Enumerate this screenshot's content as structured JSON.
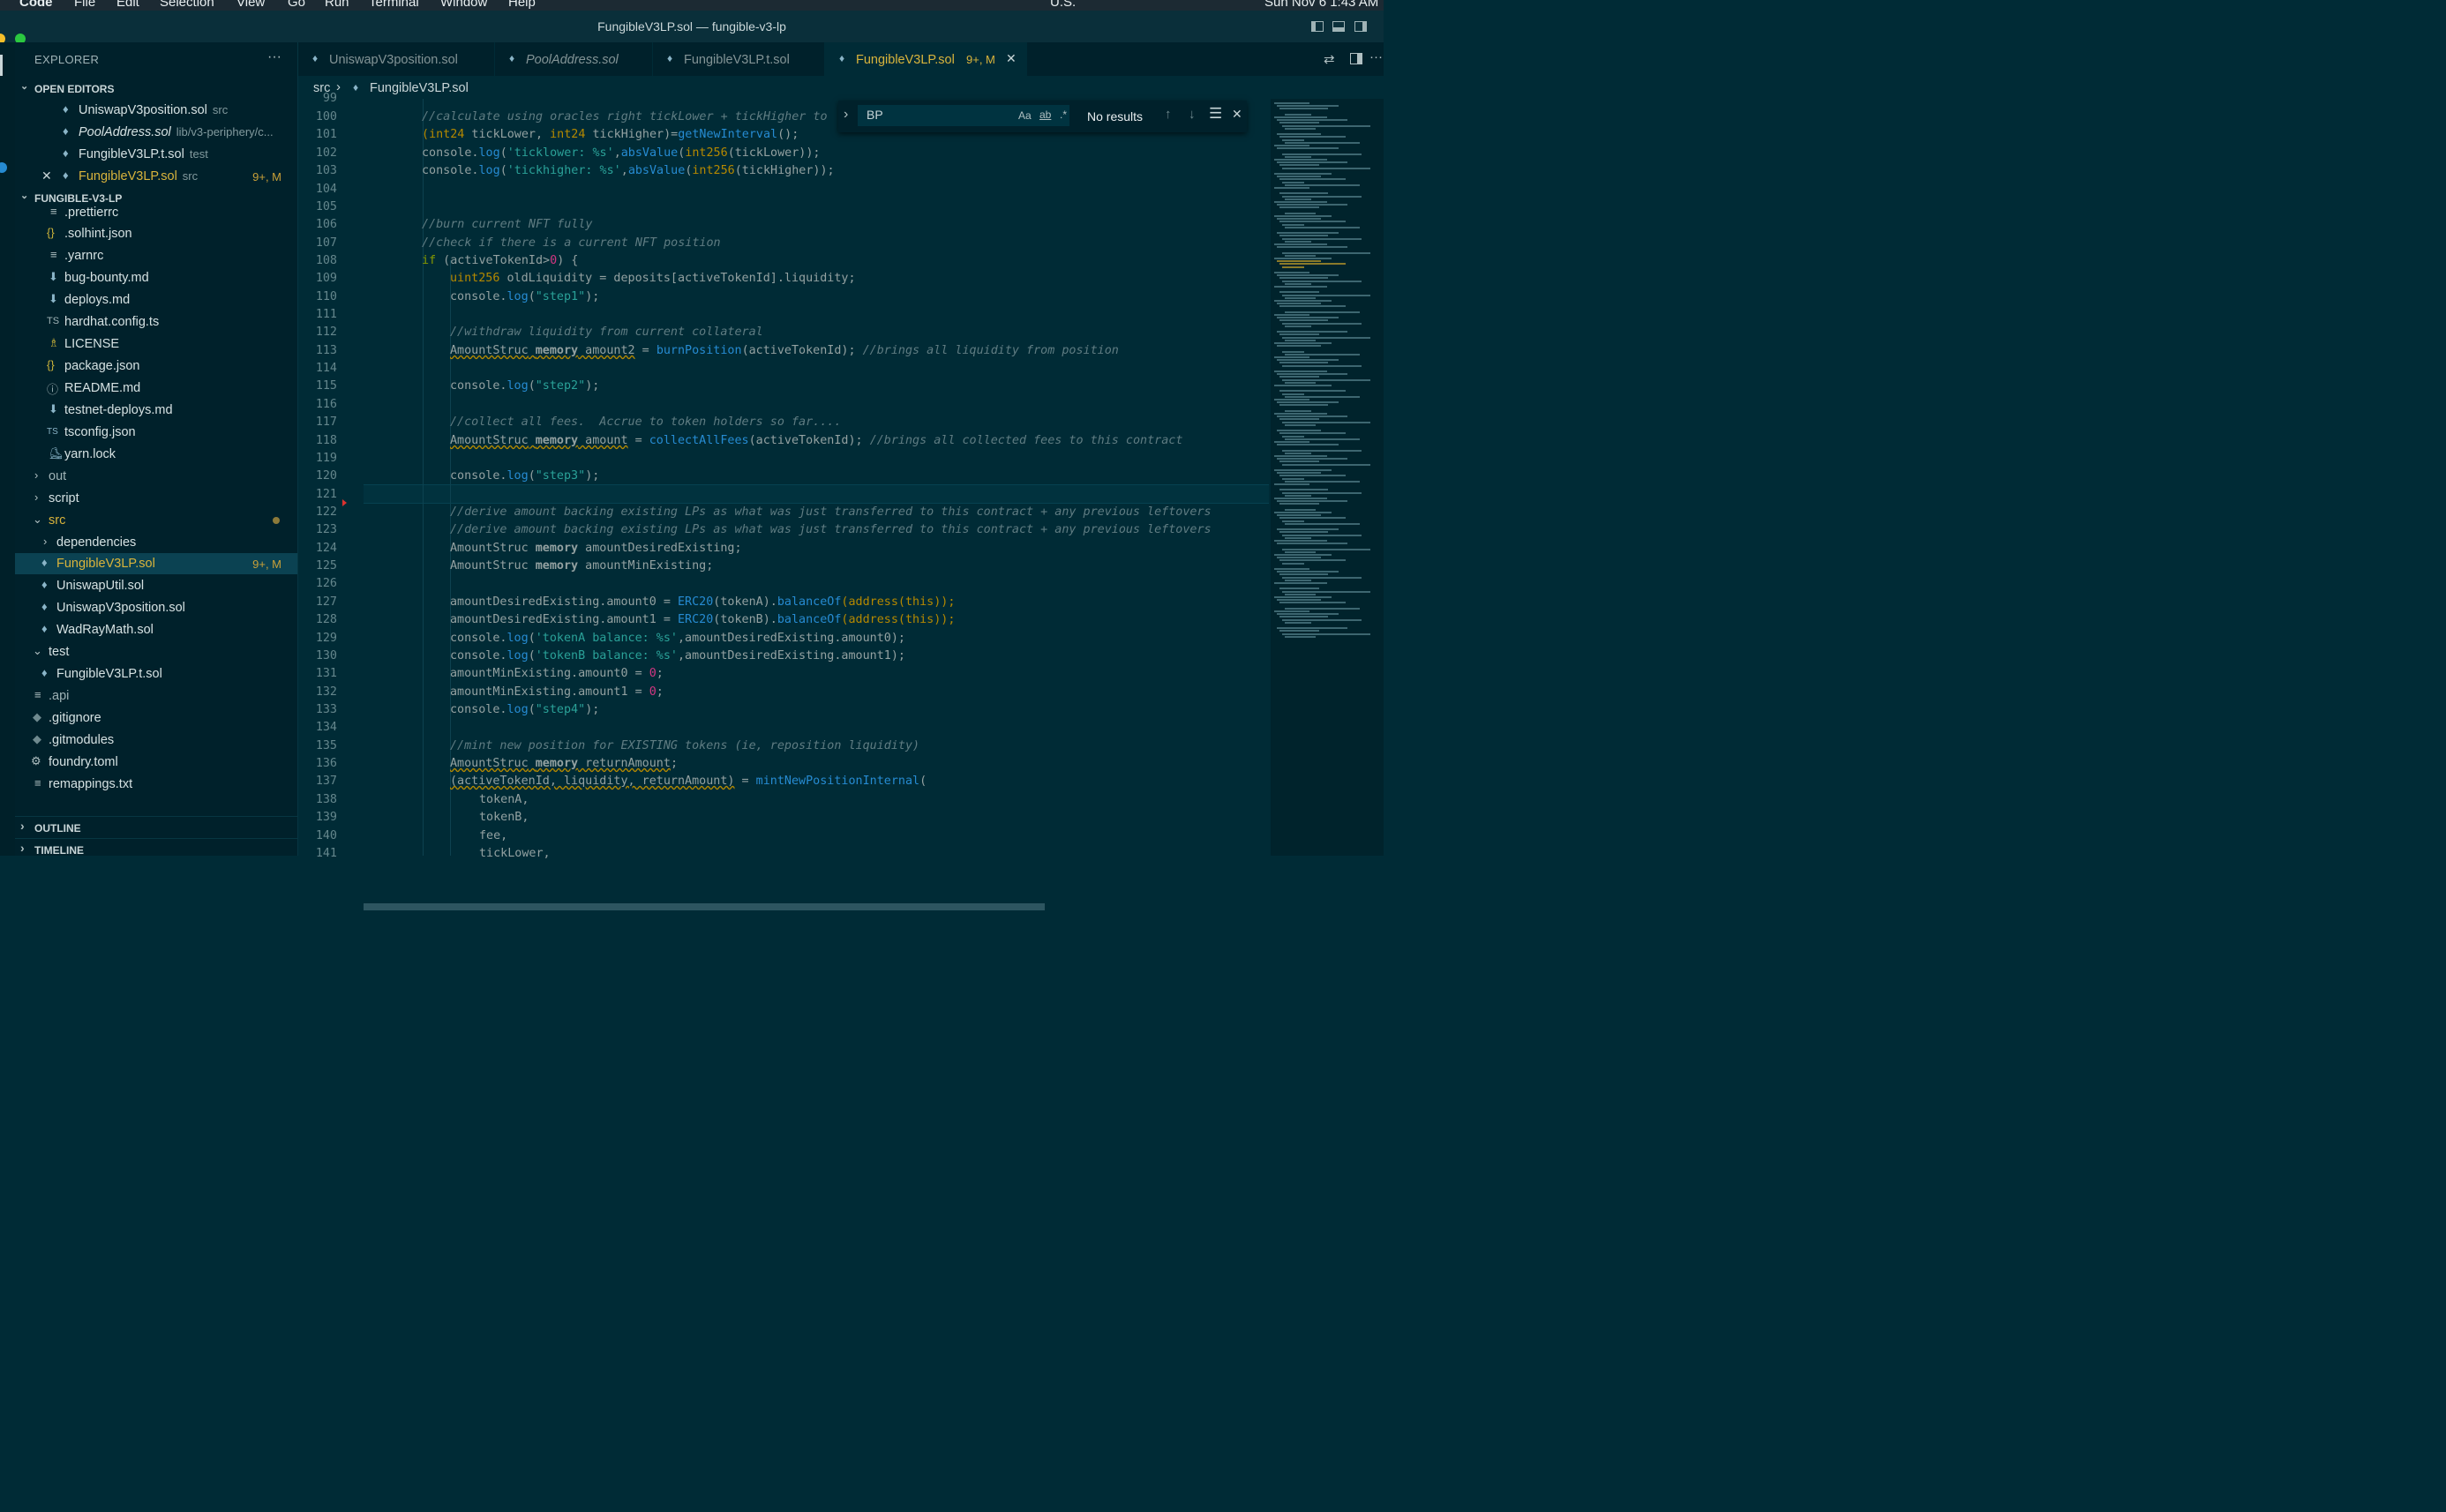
{
  "menubar": {
    "items": [
      "Code",
      "File",
      "Edit",
      "Selection",
      "View",
      "Go",
      "Run",
      "Terminal",
      "Window",
      "Help"
    ],
    "clock": "Sun Nov 6  1:43 AM",
    "input_source": "U.S."
  },
  "window": {
    "title": "FungibleV3LP.sol — fungible-v3-lp"
  },
  "sidebar": {
    "header": "EXPLORER",
    "more": "···",
    "open_editors_title": "OPEN EDITORS",
    "open_editors": [
      {
        "name": "UniswapV3position.sol",
        "desc": "src"
      },
      {
        "name": "PoolAddress.sol",
        "desc": "lib/v3-periphery/c..."
      },
      {
        "name": "FungibleV3LP.t.sol",
        "desc": "test"
      },
      {
        "name": "FungibleV3LP.sol",
        "desc": "src",
        "badge": "9+, M"
      }
    ],
    "project_title": "FUNGIBLE-V3-LP",
    "tree": [
      {
        "name": ".prettierrc"
      },
      {
        "name": ".solhint.json"
      },
      {
        "name": ".yarnrc"
      },
      {
        "name": "bug-bounty.md"
      },
      {
        "name": "deploys.md"
      },
      {
        "name": "hardhat.config.ts"
      },
      {
        "name": "LICENSE"
      },
      {
        "name": "package.json"
      },
      {
        "name": "README.md"
      },
      {
        "name": "testnet-deploys.md"
      },
      {
        "name": "tsconfig.json"
      },
      {
        "name": "yarn.lock"
      },
      {
        "name": "out"
      },
      {
        "name": "script"
      },
      {
        "name": "src"
      },
      {
        "name": "dependencies"
      },
      {
        "name": "FungibleV3LP.sol",
        "badge": "9+, M"
      },
      {
        "name": "UniswapUtil.sol"
      },
      {
        "name": "UniswapV3position.sol"
      },
      {
        "name": "WadRayMath.sol"
      },
      {
        "name": "test"
      },
      {
        "name": "FungibleV3LP.t.sol"
      },
      {
        "name": ".api"
      },
      {
        "name": ".gitignore"
      },
      {
        "name": ".gitmodules"
      },
      {
        "name": "foundry.toml"
      },
      {
        "name": "remappings.txt"
      }
    ],
    "outline_title": "OUTLINE",
    "timeline_title": "TIMELINE"
  },
  "tabs": [
    {
      "label": "UniswapV3position.sol"
    },
    {
      "label": "PoolAddress.sol"
    },
    {
      "label": "FungibleV3LP.t.sol"
    },
    {
      "label": "FungibleV3LP.sol",
      "badge": "9+, M"
    }
  ],
  "breadcrumb": {
    "folder": "src",
    "file": "FungibleV3LP.sol"
  },
  "find": {
    "query": "BP",
    "result": "No results",
    "opt_case": "Aa",
    "opt_word": "ab",
    "opt_regex": ".*"
  },
  "code": {
    "line_numbers": [
      "99",
      "100",
      "101",
      "102",
      "103",
      "104",
      "105",
      "106",
      "107",
      "108",
      "109",
      "110",
      "111",
      "112",
      "113",
      "114",
      "115",
      "116",
      "117",
      "118",
      "119",
      "120",
      "121",
      "122",
      "123",
      "124",
      "125",
      "126",
      "127",
      "128",
      "129",
      "130",
      "131",
      "132",
      "133",
      "134",
      "135",
      "136",
      "137",
      "138",
      "139",
      "140",
      "141"
    ],
    "text": {
      "l100": "//calculate using oracles right tickLower + tickHigher to",
      "l101a": "(",
      "l101b": "int24",
      "l101c": " tickLower, ",
      "l101d": "int24",
      "l101e": " tickHigher)=",
      "l101f": "getNewInterval",
      "l101g": "();",
      "l102a": "console.",
      "l102b": "log",
      "l102c": "(",
      "l102d": "'ticklower: %s'",
      "l102e": ",",
      "l102f": "absValue",
      "l102g": "(",
      "l102h": "int256",
      "l102i": "(tickLower));",
      "l103a": "console.",
      "l103b": "log",
      "l103c": "(",
      "l103d": "'tickhigher: %s'",
      "l103e": ",",
      "l103f": "absValue",
      "l103g": "(",
      "l103h": "int256",
      "l103i": "(tickHigher));",
      "l106": "//burn current NFT fully",
      "l107": "//check if there is a current NFT position",
      "l108a": "if",
      "l108b": " (activeTokenId>",
      "l108c": "0",
      "l108d": ") {",
      "l109a": "uint256",
      "l109b": " oldLiquidity = deposits[activeTokenId].liquidity;",
      "l110a": "console.",
      "l110b": "log",
      "l110c": "(",
      "l110d": "\"step1\"",
      "l110e": ");",
      "l112": "//withdraw liquidity from current collateral",
      "l113a": "AmountStruc",
      "l113b": " ",
      "l113c": "memory",
      "l113d": " amount2",
      "l113e": " = ",
      "l113f": "burnPosition",
      "l113g": "(activeTokenId); ",
      "l113h": "//brings all liquidity from position",
      "l115a": "console.",
      "l115b": "log",
      "l115c": "(",
      "l115d": "\"step2\"",
      "l115e": ");",
      "l117": "//collect all fees.  Accrue to token holders so far....",
      "l118a": "AmountStruc",
      "l118b": " ",
      "l118c": "memory",
      "l118d": " amount",
      "l118e": " = ",
      "l118f": "collectAllFees",
      "l118g": "(activeTokenId); ",
      "l118h": "//brings all collected fees to this contract",
      "l120a": "console.",
      "l120b": "log",
      "l120c": "(",
      "l120d": "\"step3\"",
      "l120e": ");",
      "l122": "//derive amount backing existing LPs as what was just transferred to this contract + any previous leftovers",
      "l123": "//derive amount backing existing LPs as what was just transferred to this contract + any previous leftovers",
      "l124a": "AmountStruc ",
      "l124b": "memory",
      "l124c": " amountDesiredExisting;",
      "l125a": "AmountStruc ",
      "l125b": "memory",
      "l125c": " amountMinExisting;",
      "l127a": "amountDesiredExisting.amount0 = ",
      "l127b": "ERC20",
      "l127c": "(tokenA).",
      "l127d": "balanceOf",
      "l127e": "(",
      "l127f": "address",
      "l127g": "(",
      "l127h": "this",
      "l127i": "));",
      "l128a": "amountDesiredExisting.amount1 = ",
      "l128b": "ERC20",
      "l128c": "(tokenB).",
      "l128d": "balanceOf",
      "l128e": "(",
      "l128f": "address",
      "l128g": "(",
      "l128h": "this",
      "l128i": "));",
      "l129a": "console.",
      "l129b": "log",
      "l129c": "(",
      "l129d": "'tokenA balance: %s'",
      "l129e": ",amountDesiredExisting.amount0);",
      "l130a": "console.",
      "l130b": "log",
      "l130c": "(",
      "l130d": "'tokenB balance: %s'",
      "l130e": ",amountDesiredExisting.amount1);",
      "l131a": "amountMinExisting.amount0 = ",
      "l131b": "0",
      "l131c": ";",
      "l132a": "amountMinExisting.amount1 = ",
      "l132b": "0",
      "l132c": ";",
      "l133a": "console.",
      "l133b": "log",
      "l133c": "(",
      "l133d": "\"step4\"",
      "l133e": ");",
      "l135": "//mint new position for EXISTING tokens (ie, reposition liquidity)",
      "l136a": "AmountStruc",
      "l136b": " ",
      "l136c": "memory",
      "l136d": " returnAmount",
      "l136e": ";",
      "l137a": "(activeTokenId, liquidity, returnAmount)",
      "l137b": " = ",
      "l137c": "mintNewPositionInternal",
      "l137d": "(",
      "l138": "tokenA,",
      "l139": "tokenB,",
      "l140": "fee,",
      "l141": "tickLower,"
    }
  },
  "colors": {
    "editor_bg": "#002b36",
    "sidebar_bg": "#00212b",
    "accent_modified": "#d9b43c",
    "comment": "#5f7c82",
    "keyword": "#859900",
    "type": "#b58900",
    "function": "#268bd2",
    "string": "#2aa198",
    "number": "#d33682"
  }
}
